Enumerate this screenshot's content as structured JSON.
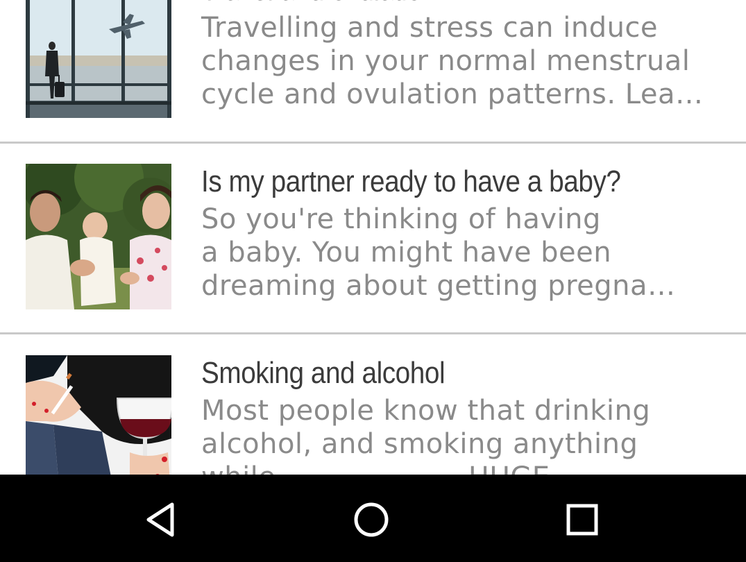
{
  "articles": [
    {
      "title": "Travel and ovulation",
      "snippet_lines": [
        "Travelling and stress can induce",
        "changes in your normal menstrual",
        "cycle and ovulation patterns. Lea…"
      ],
      "image": "airport-traveler-image"
    },
    {
      "title": "Is my partner ready to have a baby?",
      "snippet_lines": [
        "So you're thinking of having",
        "a baby. You might have been",
        "dreaming about getting pregna…"
      ],
      "image": "family-with-baby-image"
    },
    {
      "title": "Smoking and alcohol",
      "snippet_lines": [
        "Most people know that drinking",
        "alcohol, and smoking anything",
        "while ..... ..... ....... HUGE ..."
      ],
      "image": "cigarette-and-wine-image"
    }
  ],
  "navbar": {
    "back": "back-triangle-icon",
    "home": "home-circle-icon",
    "recents": "recents-square-icon",
    "background": "#000000",
    "icon_color": "#ffffff"
  },
  "colors": {
    "title": "#3b3b3b",
    "snippet": "#8a8a8a",
    "divider": "#c9c9c9"
  }
}
